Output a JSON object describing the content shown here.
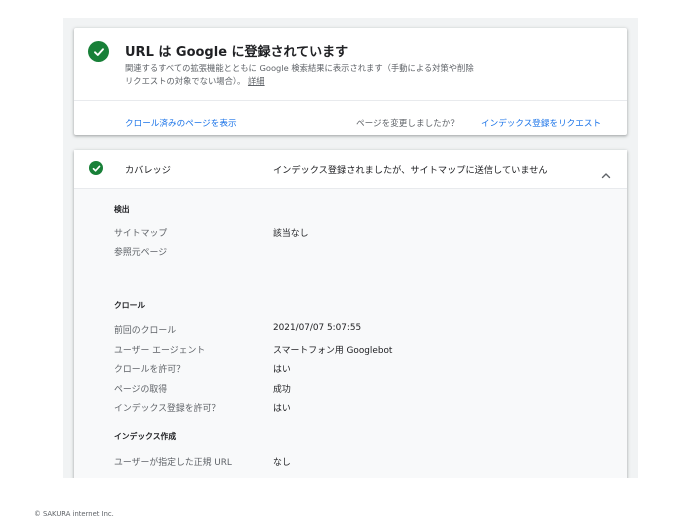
{
  "status_card": {
    "title": "URL は Google に登録されています",
    "description": "関連するすべての拡張機能とともに Google 検索結果に表示されます（手動による対策や削除リクエストの対象でない場合）。",
    "details_link": "詳細",
    "view_crawled_page": "クロール済みのページを表示",
    "page_changed_question": "ページを変更しましたか？",
    "request_indexing": "インデックス登録をリクエスト"
  },
  "coverage": {
    "title": "カバレッジ",
    "status": "インデックス登録されましたが、サイトマップに送信していません",
    "discovery": {
      "heading": "検出",
      "sitemap_label": "サイトマップ",
      "sitemap_value": "該当なし",
      "referring_page_label": "参照元ページ"
    },
    "crawl": {
      "heading": "クロール",
      "last_crawl_label": "前回のクロール",
      "last_crawl_value": "2021/07/07 5:07:55",
      "crawled_as_label": "ユーザー エージェント",
      "crawled_as_value": "スマートフォン用 Googlebot",
      "crawl_allowed_label": "クロールを許可？",
      "crawl_allowed_value": "はい",
      "page_fetch_label": "ページの取得",
      "page_fetch_value": "成功",
      "indexing_allowed_label": "インデックス登録を許可？",
      "indexing_allowed_value": "はい"
    },
    "indexing": {
      "heading": "インデックス作成",
      "user_canonical_label": "ユーザーが指定した正規 URL",
      "user_canonical_value": "なし"
    }
  },
  "footer": {
    "copyright": "© SAKURA internet Inc."
  },
  "colors": {
    "success": "#188038",
    "link": "#1a73e8",
    "muted": "#5f6368"
  },
  "icons": [
    "check-circle-icon",
    "chevron-up-icon"
  ]
}
